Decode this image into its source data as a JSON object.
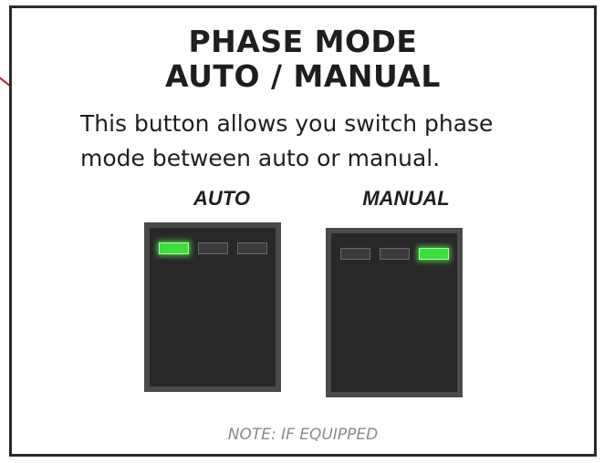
{
  "title": {
    "line1": "PHASE MODE",
    "line2": "AUTO / MANUAL"
  },
  "description": {
    "line1": "This button allows you switch phase",
    "line2": "mode between auto or manual."
  },
  "panels": [
    {
      "label": "AUTO",
      "leds": [
        true,
        false,
        false
      ]
    },
    {
      "label": "MANUAL",
      "leds": [
        false,
        false,
        true
      ]
    }
  ],
  "colors": {
    "led_on": "#39e03c",
    "led_off": "#3b3b3b",
    "panel": "#282828",
    "panel_border": "#4a4a4a",
    "accent_line": "#c0262c"
  },
  "note": "NOTE: IF EQUIPPED"
}
